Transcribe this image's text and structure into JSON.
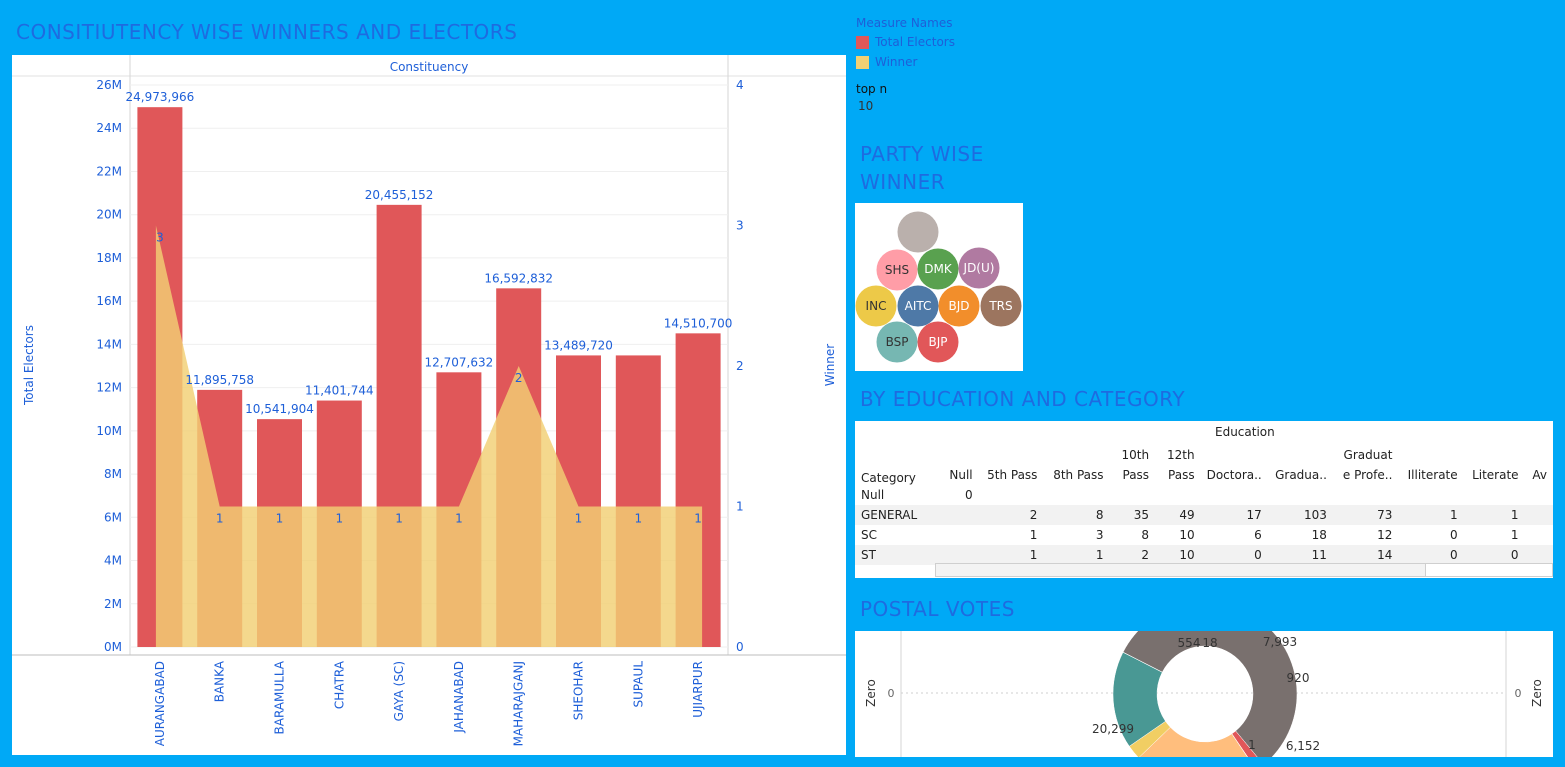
{
  "main_chart": {
    "title": "CONSITIUTENCY WISE WINNERS AND ELECTORS",
    "header": "Constituency",
    "y_left_label": "Total Electors",
    "y_right_label": "Winner"
  },
  "legend": {
    "title": "Measure Names",
    "items": [
      {
        "label": "Total Electors",
        "color": "#E05759"
      },
      {
        "label": "Winner",
        "color": "#F2D074"
      }
    ]
  },
  "filter": {
    "label": "top n",
    "value": "10"
  },
  "party": {
    "title_line1": "PARTY WISE",
    "title_line2": "WINNER",
    "bubbles": [
      {
        "label": "",
        "color": "#BAB0AC"
      },
      {
        "label": "SHS",
        "color": "#FF9DA7"
      },
      {
        "label": "DMK",
        "color": "#59A14F"
      },
      {
        "label": "JD(U)",
        "color": "#B07AA1"
      },
      {
        "label": "INC",
        "color": "#EDC948"
      },
      {
        "label": "AITC",
        "color": "#4E79A7"
      },
      {
        "label": "BJD",
        "color": "#F28E2B"
      },
      {
        "label": "TRS",
        "color": "#9C755F"
      },
      {
        "label": "BSP",
        "color": "#76B7B2"
      },
      {
        "label": "BJP",
        "color": "#E15759"
      }
    ]
  },
  "education": {
    "title": "BY EDUCATION AND CATEGORY",
    "header": "Education",
    "row_header": "Category",
    "columns": [
      [
        "",
        "Null"
      ],
      [
        "",
        "5th Pass"
      ],
      [
        "",
        "8th Pass"
      ],
      [
        "10th",
        "Pass"
      ],
      [
        "12th",
        "Pass"
      ],
      [
        "",
        "Doctora.."
      ],
      [
        "",
        "Gradua.."
      ],
      [
        "Graduat",
        "e Profe.."
      ],
      [
        "",
        "Illiterate"
      ],
      [
        "",
        "Literate"
      ],
      [
        "",
        "Av"
      ]
    ],
    "rows": [
      {
        "category": "Null",
        "values": [
          "0",
          "",
          "",
          "",
          "",
          "",
          "",
          "",
          "",
          "",
          ""
        ]
      },
      {
        "category": "GENERAL",
        "values": [
          "",
          "2",
          "8",
          "35",
          "49",
          "17",
          "103",
          "73",
          "1",
          "1",
          ""
        ]
      },
      {
        "category": "SC",
        "values": [
          "",
          "1",
          "3",
          "8",
          "10",
          "6",
          "18",
          "12",
          "0",
          "1",
          ""
        ]
      },
      {
        "category": "ST",
        "values": [
          "",
          "1",
          "1",
          "2",
          "10",
          "0",
          "11",
          "14",
          "0",
          "0",
          ""
        ]
      }
    ]
  },
  "postal": {
    "title": "POSTAL VOTES",
    "left_axis": "Zero",
    "left_tick": "0",
    "right_axis": "Zero",
    "right_tick": "0"
  },
  "chart_data": [
    {
      "type": "bar",
      "title": "CONSITIUTENCY WISE WINNERS AND ELECTORS",
      "xlabel": "Constituency",
      "ylabel": "Total Electors",
      "y2label": "Winner",
      "categories": [
        "AURANGABAD",
        "BANKA",
        "BARAMULLA",
        "CHATRA",
        "GAYA (SC)",
        "JAHANABAD",
        "MAHARAJGANJ",
        "SHEOHAR",
        "SUPAUL",
        "UJIARPUR"
      ],
      "series": [
        {
          "name": "Total Electors",
          "type": "bar",
          "axis": "left",
          "color": "#E05759",
          "values": [
            24973966,
            11895758,
            10541904,
            11401744,
            20455152,
            12707632,
            16592832,
            13489720,
            13489720,
            14510700
          ],
          "labels": [
            "24,973,966",
            "11,895,758",
            "10,541,904",
            "11,401,744",
            "20,455,152",
            "12,707,632",
            "16,592,832",
            "13,489,720",
            "",
            "14,510,700"
          ]
        },
        {
          "name": "Winner",
          "type": "area",
          "axis": "right",
          "color": "#F2D074",
          "values": [
            3,
            1,
            1,
            1,
            1,
            1,
            2,
            1,
            1,
            1
          ],
          "labels": [
            "3",
            "1",
            "1",
            "1",
            "1",
            "1",
            "2",
            "1",
            "1",
            "1"
          ]
        }
      ],
      "ylim": [
        0,
        26000000
      ],
      "y_ticks": [
        "0M",
        "2M",
        "4M",
        "6M",
        "8M",
        "10M",
        "12M",
        "14M",
        "16M",
        "18M",
        "20M",
        "22M",
        "24M",
        "26M"
      ],
      "y2lim": [
        0,
        4
      ],
      "y2_ticks": [
        "0",
        "1",
        "2",
        "3",
        "4"
      ],
      "grid": true,
      "legend": "top-right"
    },
    {
      "type": "pie",
      "title": "POSTAL VOTES",
      "donut": true,
      "slices": [
        {
          "value": 20299,
          "label": "20,299",
          "color": "#79706E"
        },
        {
          "value": 554,
          "label": "554",
          "color": "#E15759"
        },
        {
          "value": 18,
          "label": "18",
          "color": "#B07AA1"
        },
        {
          "value": 7993,
          "label": "7,993",
          "color": "#FFBE7D"
        },
        {
          "value": 920,
          "label": "920",
          "color": "#F1CE63"
        },
        {
          "value": 6152,
          "label": "6,152",
          "color": "#499894"
        },
        {
          "value": 1,
          "label": "1",
          "color": "#59A14F"
        }
      ]
    }
  ]
}
